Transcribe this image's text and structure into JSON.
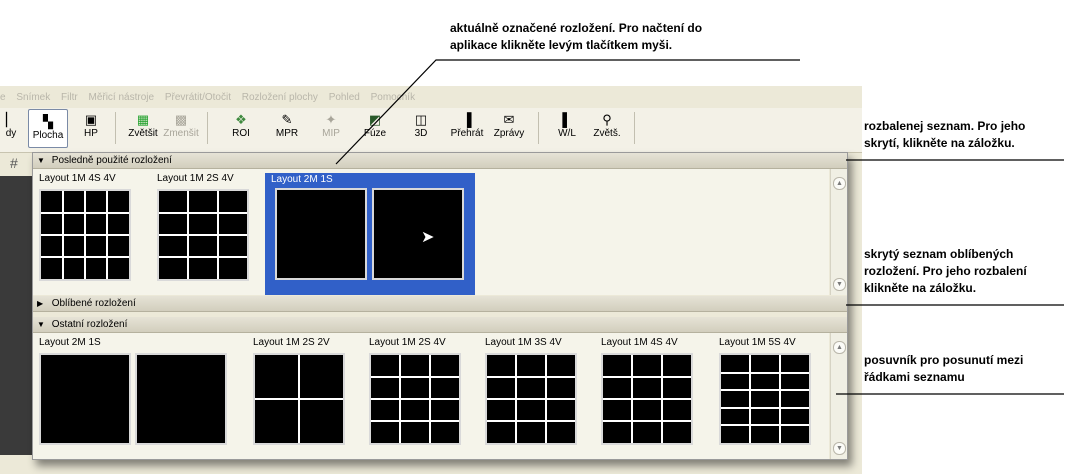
{
  "menu": [
    "e",
    "Snímek",
    "Filtr",
    "Měřicí nástroje",
    "Převrátit/Otočit",
    "Rozložení plochy",
    "Pohled",
    "Pomocník"
  ],
  "toolbar": {
    "items": [
      {
        "label": "dy",
        "icon": "partial-icon"
      },
      {
        "label": "Plocha",
        "icon": "desktop-layout-icon"
      },
      {
        "label": "HP",
        "icon": "hanging-protocol-icon"
      },
      {
        "label": "Zvětšit",
        "icon": "zoom-in-green-icon"
      },
      {
        "label": "Zmenšit",
        "icon": "zoom-out-icon"
      },
      {
        "label": "ROI",
        "icon": "roi-icon"
      },
      {
        "label": "MPR",
        "icon": "mpr-icon"
      },
      {
        "label": "MIP",
        "icon": "mip-icon"
      },
      {
        "label": "Fúze",
        "icon": "fusion-icon"
      },
      {
        "label": "3D",
        "icon": "cube-icon"
      },
      {
        "label": "Přehrát",
        "icon": "play-icon"
      },
      {
        "label": "Zprávy",
        "icon": "report-icon"
      },
      {
        "label": "W/L",
        "icon": "window-level-icon"
      },
      {
        "label": "Zvětš.",
        "icon": "magnifier-icon"
      }
    ]
  },
  "sections": {
    "recent": {
      "title": "Posledně použité rozložení",
      "expanded": true
    },
    "favorites": {
      "title": "Oblíbené rozložení",
      "expanded": false
    },
    "other": {
      "title": "Ostatní rozložení",
      "expanded": true
    }
  },
  "recent_items": [
    {
      "label": "Layout 1M 4S 4V",
      "rows": 4,
      "cols": 4,
      "selected": false
    },
    {
      "label": "Layout 1M 2S 4V",
      "rows": 4,
      "cols": 3,
      "selected": false
    },
    {
      "label": "Layout 2M 1S",
      "tiles": 2,
      "selected": true
    }
  ],
  "other_items": [
    {
      "label": "Layout 2M 1S",
      "tiles": 2
    },
    {
      "label": "Layout 1M 2S 2V",
      "rows": 2,
      "cols": 2
    },
    {
      "label": "Layout 1M 2S 4V",
      "rows": 4,
      "cols": 3
    },
    {
      "label": "Layout 1M 3S 4V",
      "rows": 4,
      "cols": 3
    },
    {
      "label": "Layout 1M 4S 4V",
      "rows": 4,
      "cols": 3
    },
    {
      "label": "Layout 1M 5S 4V",
      "rows": 5,
      "cols": 3
    }
  ],
  "annotations": {
    "top": [
      "aktuálně označené rozložení. Pro načtení do",
      "aplikace klikněte levým tlačítkem myši."
    ],
    "expanded": [
      "rozbalenej seznam. Pro jeho",
      "skrytí, klikněte na záložku."
    ],
    "hidden": [
      "skrytý seznam oblíbených",
      "rozložení. Pro jeho rozbalení",
      "klikněte na záložku."
    ],
    "scrollbar": [
      "posuvník pro posunutí mezi",
      "řádkami seznamu"
    ]
  },
  "colors": {
    "selection": "#3160c8",
    "tile": "#000000",
    "panel": "#ece9d8"
  }
}
